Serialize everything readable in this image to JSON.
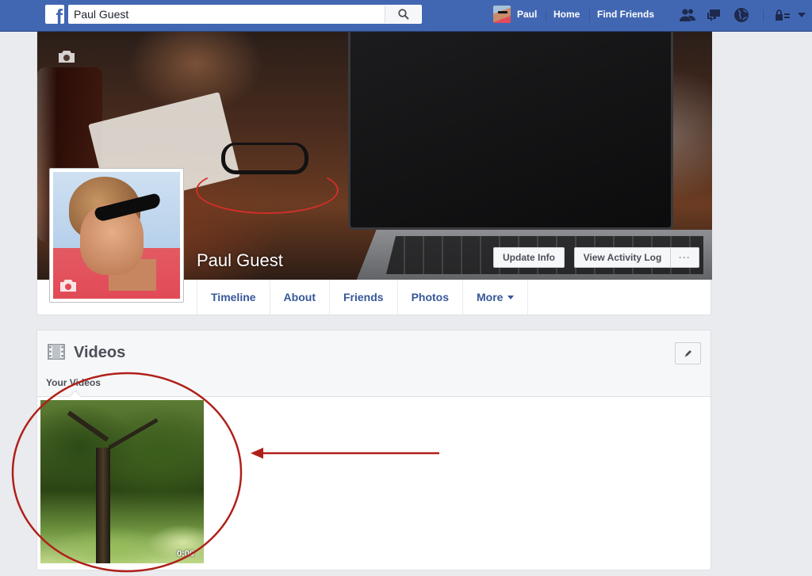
{
  "topbar": {
    "search_value": "Paul Guest",
    "user_name": "Paul",
    "home_label": "Home",
    "find_friends_label": "Find Friends",
    "icons": [
      "friend-requests-icon",
      "messages-icon",
      "notifications-globe-icon",
      "privacy-lock-icon",
      "account-caret-icon"
    ]
  },
  "profile": {
    "name": "Paul Guest",
    "update_info_label": "Update Info",
    "activity_log_label": "View Activity Log",
    "more_options_label": "···"
  },
  "tabs": [
    {
      "label": "Timeline"
    },
    {
      "label": "About"
    },
    {
      "label": "Friends"
    },
    {
      "label": "Photos"
    },
    {
      "label": "More"
    }
  ],
  "videos": {
    "title": "Videos",
    "subtab_label": "Your Videos",
    "items": [
      {
        "duration": "0:06"
      }
    ]
  },
  "colors": {
    "brand_blue": "#4267b2",
    "link_blue": "#365899",
    "annotation_red": "#b0201a"
  }
}
